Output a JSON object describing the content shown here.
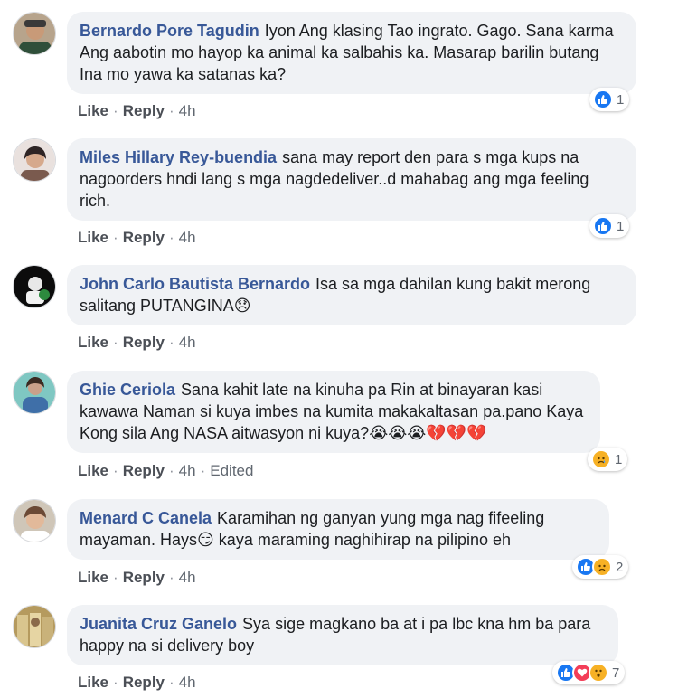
{
  "actions": {
    "like": "Like",
    "reply": "Reply"
  },
  "comments": [
    {
      "author": "Bernardo Pore Tagudin",
      "text": "Iyon Ang klasing Tao ingrato. Gago. Sana karma Ang aabotin mo hayop ka animal ka salbahis ka. Masarap barilin butang Ina mo yawa ka satanas ka?",
      "time": "4h",
      "edited": "",
      "reactions": [
        "like-icon"
      ],
      "reaction_count": "1"
    },
    {
      "author": "Miles Hillary Rey-buendia",
      "text": "sana may report den para s mga kups na nagoorders hndi lang s mga nagdedeliver..d mahabag ang mga feeling rich.",
      "time": "4h",
      "edited": "",
      "reactions": [
        "like-icon"
      ],
      "reaction_count": "1"
    },
    {
      "author": "John Carlo Bautista Bernardo",
      "text": "Isa sa mga dahilan kung bakit merong salitang PUTANGINA😞",
      "time": "4h",
      "edited": "",
      "reactions": [],
      "reaction_count": ""
    },
    {
      "author": "Ghie Ceriola",
      "text": "Sana kahit late na kinuha pa Rin at binayaran kasi kawawa Naman si kuya imbes na kumita makakaltasan pa.pano Kaya Kong sila Ang NASA aitwasyon ni kuya?😭😭😭💔💔💔",
      "time": "4h",
      "edited": "Edited",
      "reactions": [
        "sad-icon"
      ],
      "reaction_count": "1"
    },
    {
      "author": "Menard C Canela",
      "text": "Karamihan ng ganyan yung mga nag fifeeling mayaman. Hays😏 kaya maraming naghihirap na pilipino eh",
      "time": "4h",
      "edited": "",
      "reactions": [
        "like-icon",
        "sad-icon"
      ],
      "reaction_count": "2"
    },
    {
      "author": "Juanita Cruz Ganelo",
      "text": "Sya sige magkano ba at i pa lbc kna hm ba para happy na si delivery boy",
      "time": "4h",
      "edited": "",
      "reactions": [
        "like-icon",
        "love-icon",
        "wow-icon"
      ],
      "reaction_count": "7"
    }
  ]
}
